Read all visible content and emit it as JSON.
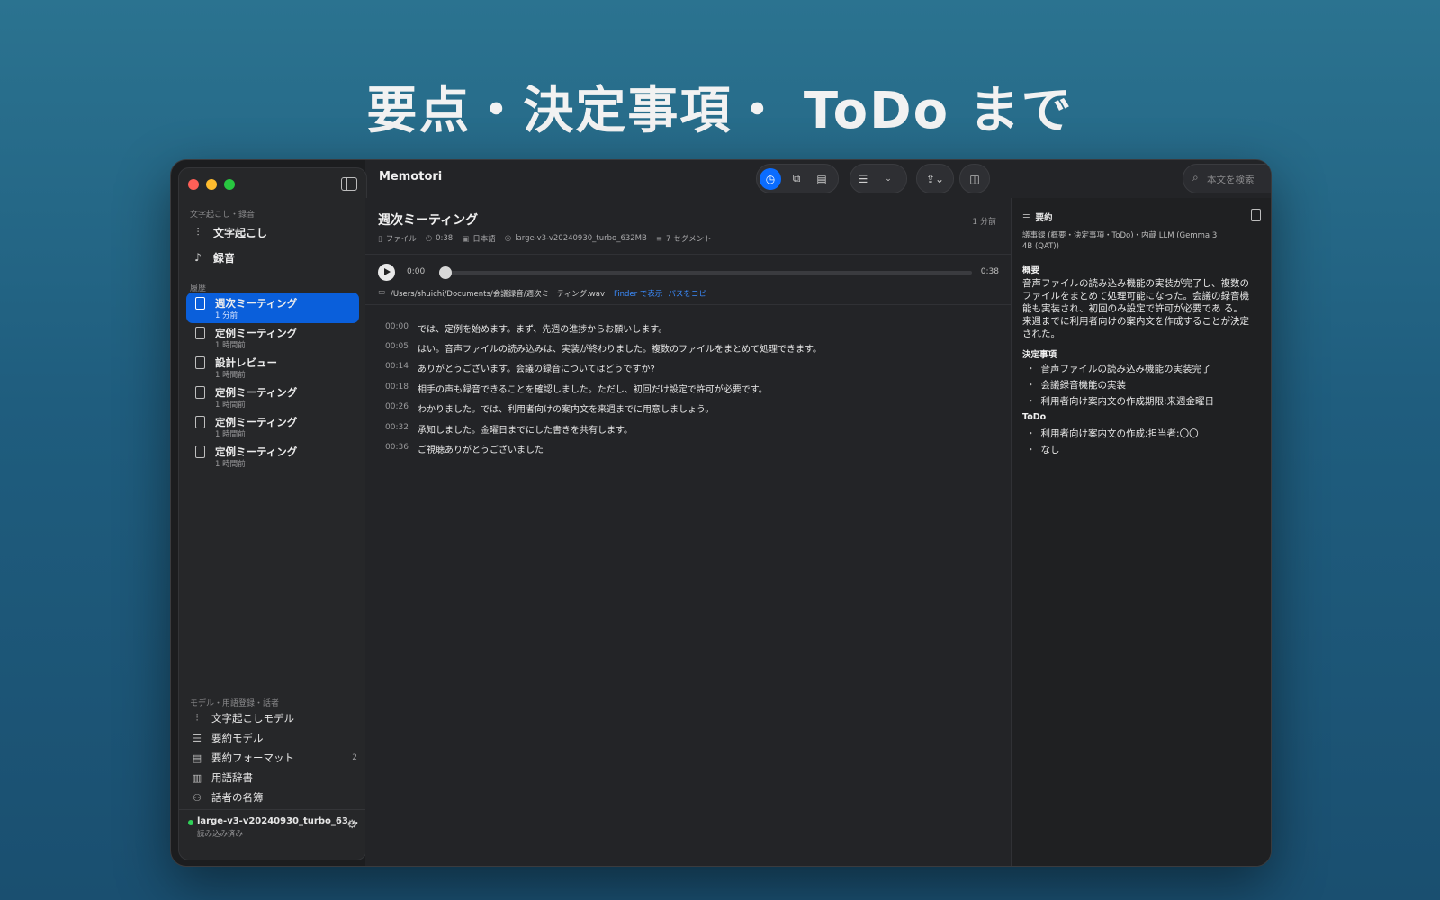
{
  "hero": "要点・決定事項・ ToDo まで",
  "app": {
    "title": "Memotori"
  },
  "search": {
    "placeholder": "本文を検索"
  },
  "sidebar": {
    "section1": "文字起こし・録音",
    "nav": [
      {
        "icon": "waveform-icon",
        "label": "文字起こし"
      },
      {
        "icon": "mic-icon",
        "label": "録音"
      }
    ],
    "history_label": "履歴",
    "history": [
      {
        "title": "週次ミーティング",
        "time": "1 分前"
      },
      {
        "title": "定例ミーティング",
        "time": "1 時間前"
      },
      {
        "title": "設計レビュー",
        "time": "1 時間前"
      },
      {
        "title": "定例ミーティング",
        "time": "1 時間前"
      },
      {
        "title": "定例ミーティング",
        "time": "1 時間前"
      },
      {
        "title": "定例ミーティング",
        "time": "1 時間前"
      }
    ],
    "section2": "モデル・用語登録・話者",
    "bottom": [
      {
        "icon": "waveform-icon",
        "label": "文字起こしモデル",
        "badge": ""
      },
      {
        "icon": "summary-lines-icon",
        "label": "要約モデル",
        "badge": ""
      },
      {
        "icon": "format-list-icon",
        "label": "要約フォーマット",
        "badge": "2"
      },
      {
        "icon": "book-icon",
        "label": "用語辞書",
        "badge": ""
      },
      {
        "icon": "people-icon",
        "label": "話者の名簿",
        "badge": ""
      }
    ],
    "model_status": {
      "name": "large-v3-v20240930_turbo_63...",
      "state": "読み込み済み",
      "color": "#2fd158"
    }
  },
  "doc": {
    "title": "週次ミーティング",
    "time_ago": "1 分前",
    "meta": {
      "source": "ファイル",
      "duration": "0:38",
      "language": "日本語",
      "model": "large-v3-v20240930_turbo_632MB",
      "segments": "7 セグメント"
    },
    "player": {
      "current": "0:00",
      "total": "0:38",
      "progress": 0
    },
    "path": "/Users/shuichi/Documents/会議録音/週次ミーティング.wav",
    "finder_link": "Finder で表示",
    "copy_path_link": "パスをコピー"
  },
  "segments": [
    {
      "ts": "00:00",
      "text": "では、定例を始めます。まず、先週の進捗からお願いします。"
    },
    {
      "ts": "00:05",
      "text": "はい。音声ファイルの読み込みは、実装が終わりました。複数のファイルをまとめて処理できます。"
    },
    {
      "ts": "00:14",
      "text": "ありがとうございます。会議の録音についてはどうですか?"
    },
    {
      "ts": "00:18",
      "text": "相手の声も録音できることを確認しました。ただし、初回だけ設定で許可が必要です。"
    },
    {
      "ts": "00:26",
      "text": "わかりました。では、利用者向けの案内文を来週までに用意しましょう。"
    },
    {
      "ts": "00:32",
      "text": "承知しました。金曜日までにした書きを共有します。"
    },
    {
      "ts": "00:36",
      "text": "ご視聴ありがとうございました"
    }
  ],
  "summary": {
    "heading": "要約",
    "subtitle": "議事録 (概要・決定事項・ToDo)・内蔵 LLM (Gemma 3 4B (QAT))",
    "overview_label": "概要",
    "overview": "音声ファイルの読み込み機能の実装が完了し、複数のファイルをまとめて処理可能になった。会議の録音機能も実装され、初回のみ設定で許可が必要であ る。来週までに利用者向けの案内文を作成することが決定された。",
    "decisions_label": "決定事項",
    "decisions": [
      "音声ファイルの読み込み機能の実装完了",
      "会議録音機能の実装",
      "利用者向け案内文の作成期限:来週金曜日"
    ],
    "todo_label": "ToDo",
    "todos": [
      "利用者向け案内文の作成:担当者:〇〇",
      "なし"
    ]
  },
  "colors": {
    "accent": "#0a5fdb",
    "link": "#3b8cff"
  }
}
